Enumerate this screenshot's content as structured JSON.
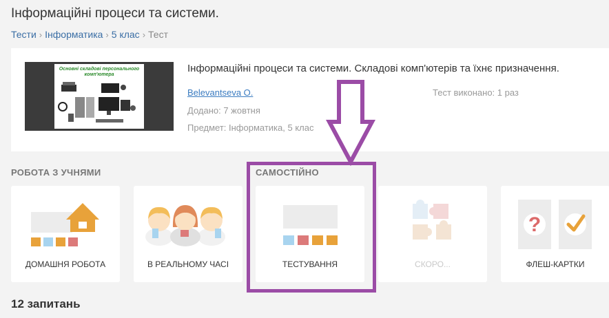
{
  "page": {
    "title": "Інформаційні процеси та системи.",
    "breadcrumb": [
      {
        "label": "Тести"
      },
      {
        "label": "Інформатика"
      },
      {
        "label": "5 клас"
      },
      {
        "label": "Тест"
      }
    ],
    "breadcrumb_separator": "›"
  },
  "test_card": {
    "thumbnail_title": "Основні складові персонального комп'ютера",
    "title": "Інформаційні процеси та системи. Складові комп'ютерів та їхнє призначення.",
    "author": "Belevantseva O.",
    "completed": "Тест виконано: 1 раз",
    "added": "Додано: 7 жовтня",
    "subject": "Предмет: Інформатика, 5 клас"
  },
  "sections": {
    "with_students": "РОБОТА З УЧНЯМИ",
    "self": "САМОСТІЙНО"
  },
  "modes": [
    {
      "label": "ДОМАШНЯ РОБОТА",
      "icon": "house-icon",
      "enabled": true
    },
    {
      "label": "В РЕАЛЬНОМУ ЧАСІ",
      "icon": "students-icon",
      "enabled": true
    },
    {
      "label": "ТЕСТУВАННЯ",
      "icon": "test-blocks-icon",
      "enabled": true
    },
    {
      "label": "СКОРО...",
      "icon": "puzzle-icon",
      "enabled": false
    },
    {
      "label": "ФЛЕШ-КАРТКИ",
      "icon": "flashcards-icon",
      "enabled": true
    }
  ],
  "questions_count": "12 запитань",
  "colors": {
    "highlight": "#9b4ca6",
    "link": "#3a7bc0",
    "accent_orange": "#e8a23a",
    "block_blue": "#a8d4ef",
    "block_red": "#dc7a7a",
    "block_orange": "#e8a23a"
  }
}
